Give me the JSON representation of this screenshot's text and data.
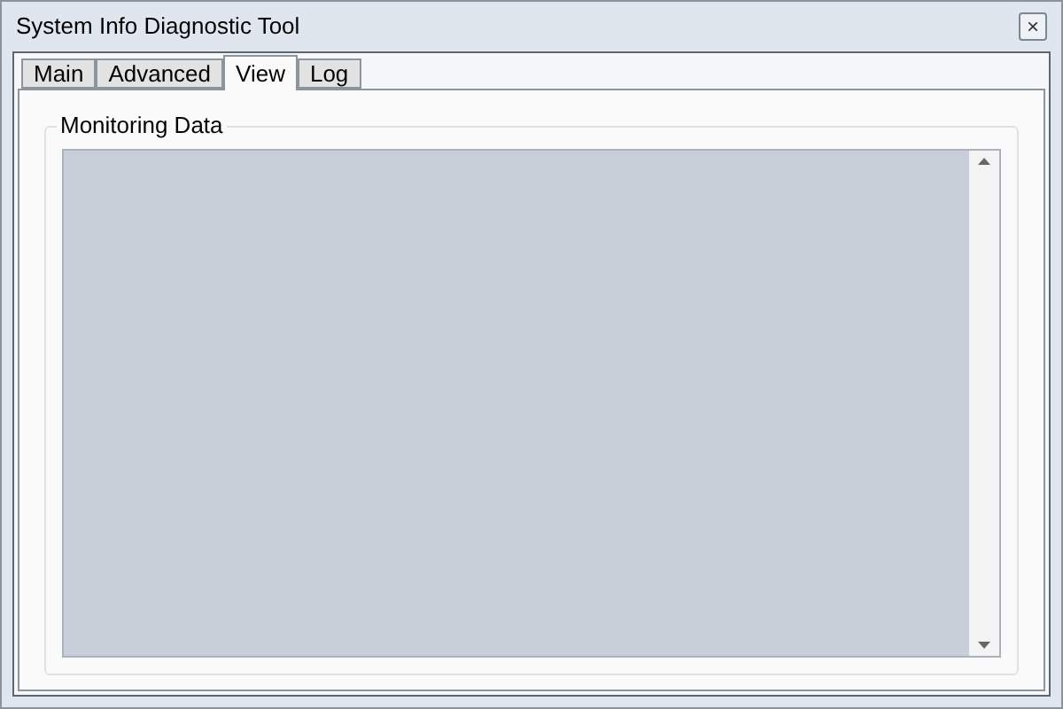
{
  "window": {
    "title": "System Info Diagnostic Tool",
    "close_glyph": "×"
  },
  "tabs": [
    {
      "label": "Main",
      "selected": false
    },
    {
      "label": "Advanced",
      "selected": false
    },
    {
      "label": "View",
      "selected": true
    },
    {
      "label": "Log",
      "selected": false
    }
  ],
  "group": {
    "title": "Monitoring Data"
  }
}
